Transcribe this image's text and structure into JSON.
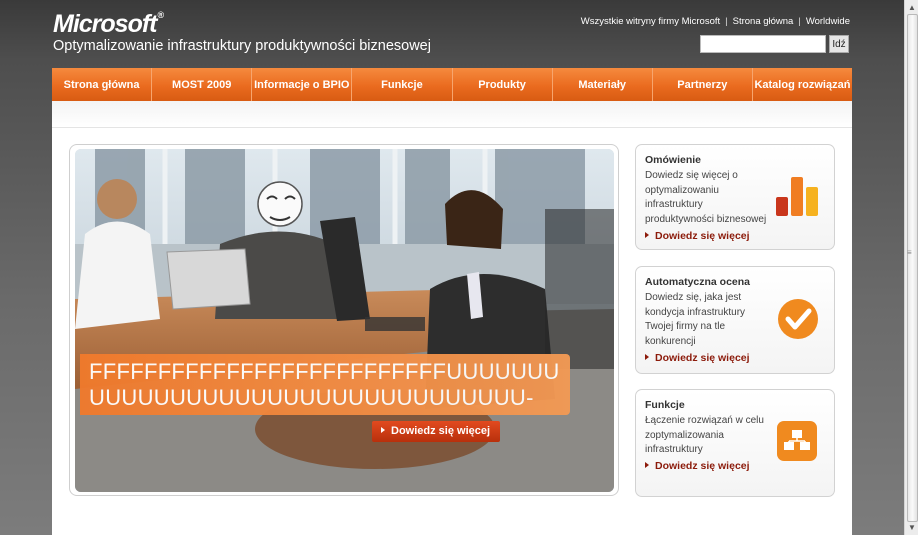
{
  "header": {
    "logo_text": "Microsoft",
    "logo_mark": "®",
    "subtitle": "Optymalizowanie infrastruktury produktywności biznesowej",
    "top_links": [
      "Wszystkie witryny firmy Microsoft",
      "Strona główna",
      "Worldwide"
    ],
    "link_separator": "|",
    "search": {
      "value": "",
      "placeholder": "",
      "button_label": "Idź"
    }
  },
  "nav": {
    "items": [
      {
        "label": "Strona główna"
      },
      {
        "label": "MOST 2009"
      },
      {
        "label": "Informacje o BPIO"
      },
      {
        "label": "Funkcje"
      },
      {
        "label": "Produkty"
      },
      {
        "label": "Materiały"
      },
      {
        "label": "Partnerzy"
      },
      {
        "label": "Katalog rozwiązań"
      }
    ]
  },
  "hero": {
    "banner_text": "FFFFFFFFFFFFFFFFFFFFFFFFFFUUUUUUU UUUUUUUUUUUUUUUUUUUUUUUUUUU-",
    "cta_label": "Dowiedz się więcej"
  },
  "cards": [
    {
      "title": "Omówienie",
      "description": "Dowiedz się więcej o optymalizowaniu infrastruktury produktywności biznesowej",
      "link": "Dowiedz się więcej",
      "icon": "bar-chart-icon"
    },
    {
      "title": "Automatyczna ocena",
      "description": "Dowiedz się, jaka jest kondycja infrastruktury Twojej firmy na tle konkurencji",
      "link": "Dowiedz się więcej",
      "icon": "checkmark-icon"
    },
    {
      "title": "Funkcje",
      "description": "Łączenie rozwiązań w celu zoptymalizowania infrastruktury",
      "link": "Dowiedz się więcej",
      "icon": "blocks-icon"
    }
  ],
  "colors": {
    "accent_orange": "#EA6B1F",
    "link_red": "#8C1B0B",
    "cta_red": "#C9380F"
  }
}
